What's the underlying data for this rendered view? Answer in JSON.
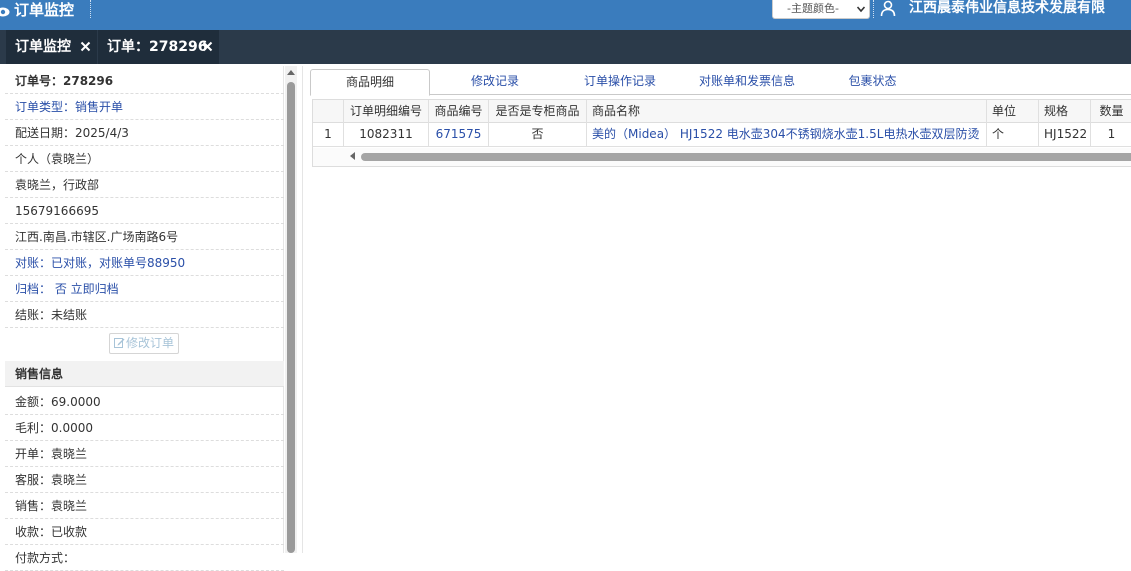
{
  "header": {
    "app_title": "订单监控",
    "theme_select": "-主题颜色-",
    "company": "江西晨泰伟业信息技术发展有限"
  },
  "tabs": [
    {
      "label": "订单监控"
    },
    {
      "label": "订单：278296"
    }
  ],
  "order_info": {
    "order_no": "订单号：278296",
    "order_type": "订单类型：销售开单",
    "delivery_date": "配送日期：2025/4/3",
    "customer": "个人（袁晓兰）",
    "contact": "袁晓兰，行政部",
    "phone": "15679166695",
    "address": "江西.南昌.市辖区.广场南路6号",
    "reconcile": "对账：已对账，对账单号88950",
    "archive": "归档：  否 立即归档",
    "settle": "结账：未结账",
    "edit_button": "修改订单"
  },
  "sales_info": {
    "section_title": "销售信息",
    "amount": "金额：69.0000",
    "profit": "毛利：0.0000",
    "issuer": "开单：袁晓兰",
    "service": "客服：袁晓兰",
    "sales": "销售：袁晓兰",
    "payment": "收款：已收款",
    "partial": "付款方式："
  },
  "detail_tabs": [
    "商品明细",
    "修改记录",
    "订单操作记录",
    "对账单和发票信息",
    "包裹状态"
  ],
  "grid": {
    "columns": [
      "",
      "订单明细编号",
      "商品编号",
      "是否是专柜商品",
      "商品名称",
      "单位",
      "规格",
      "数量"
    ],
    "rows": [
      [
        "1",
        "1082311",
        "671575",
        "否",
        "美的（Midea） HJ1522 电水壶304不锈钢烧水壶1.5L电热水壶双层防烫",
        "个",
        "HJ1522",
        "1"
      ]
    ]
  },
  "colors": {
    "header_bg": "#3a7cbd",
    "tabbar_bg": "#2b3a4a",
    "link_blue": "#2a4fa8"
  }
}
